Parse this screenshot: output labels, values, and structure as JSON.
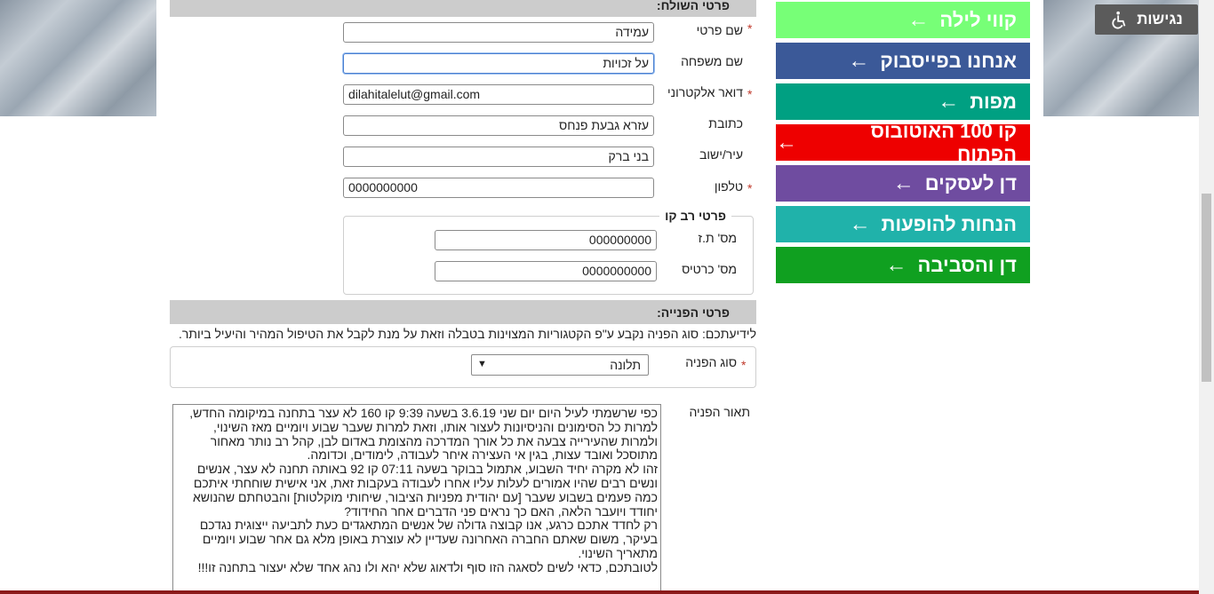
{
  "accessibility": {
    "label": "נגישות",
    "icon": "wheelchair-icon"
  },
  "nav": [
    {
      "label": "קווי לילה",
      "color": "#77ff77"
    },
    {
      "label": "אנחנו בפייסבוק",
      "color": "#3b5998"
    },
    {
      "label": "מפות",
      "color": "#00a082"
    },
    {
      "label": "קו 100 האוטובוס הפתוח",
      "color": "#ee0000"
    },
    {
      "label": "דן לעסקים",
      "color": "#6f4ca0"
    },
    {
      "label": "הנחות להופעות",
      "color": "#20b2aa"
    },
    {
      "label": "דן והסביבה",
      "color": "#10a020"
    }
  ],
  "nav_arrow": "←",
  "sender_section": {
    "title": "פרטי השולח:"
  },
  "fields": {
    "first_name": {
      "label": "שם פרטי",
      "value": "עמידה",
      "required": true
    },
    "last_name": {
      "label": "שם משפחה",
      "value": "על זכויות",
      "required": false
    },
    "email": {
      "label": "דואר אלקטרוני",
      "value": "dilahitalelut@gmail.com",
      "required": true
    },
    "address": {
      "label": "כתובת",
      "value": "עזרא גבעת פנחס",
      "required": false
    },
    "city": {
      "label": "עיר/ישוב",
      "value": "בני ברק",
      "required": false
    },
    "phone": {
      "label": "טלפון",
      "value": "0000000000",
      "required": true
    }
  },
  "rav_kav": {
    "legend": "פרטי רב קו",
    "id_label": "מס' ת.ז",
    "id_value": "000000000",
    "card_label": "מס' כרטיס",
    "card_value": "0000000000"
  },
  "inquiry_section": {
    "title": "פרטי הפנייה:",
    "info": "לידיעתכם: סוג הפניה נקבע ע\"פ הקטגוריות המצוינות בטבלה וזאת על מנת לקבל את הטיפול המהיר והיעיל ביותר.",
    "type_label": "סוג הפניה",
    "type_value": "תלונה",
    "desc_label": "תאור הפניה",
    "description": "כפי שרשמתי לעיל היום יום שני 3.6.19 בשעה 9:39 קו 160 לא עצר בתחנה במיקומה החדש, למרות כל הסימונים והניסיונות לעצור אותו, וזאת למרות שעבר שבוע ויומיים מאז השינוי, ולמרות שהעירייה צבעה את כל אורך המדרכה מהצומת באדום לבן, קהל רב נותר מאחור מתוסכל ואובד עצות, בגין אי העצירה איחר לעבודה, לימודים, וכדומה.\nזהו לא מקרה יחיד השבוע, אתמול בבוקר בשעה 07:11 קו 92 באותה תחנה לא עצר, אנשים ונשים רבים שהיו אמורים לעלות עליו אחרו לעבודה בעקבות זאת, אני אישית שוחחתי איתכם כמה פעמים בשבוע שעבר [עם יהודית מפניות הציבור, שיחותי מוקלטות] והבטחתם שהנושא יחודד ויועבר הלאה, האם כך נראים פני הדברים אחר החידוד?\nרק לחדד אתכם כרגע, אנו קבוצה גדולה של אנשים המתאגדים כעת לתביעה ייצוגית נגדכם בעיקר, משום שאתם החברה האחרונה שעדיין לא עוצרת באופן מלא גם אחר שבוע ויומיים מתאריך השינוי.\nלטובתכם, כדאי לשים לסאגה הזו סוף ולדאוג שלא יהא ולו נהג אחד שלא יעצור בתחנה זו!!!"
  },
  "required_marker": "*"
}
